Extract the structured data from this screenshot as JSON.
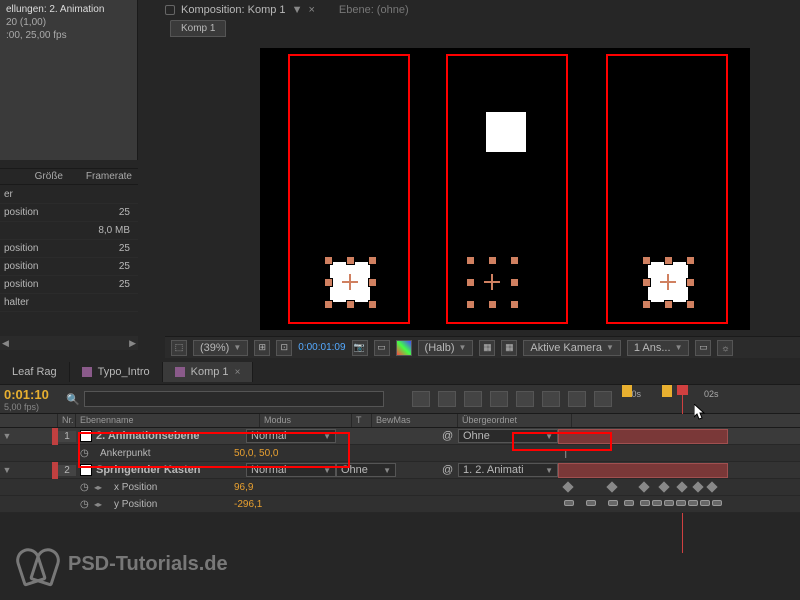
{
  "topTabs": {
    "comp": "Komposition: Komp 1",
    "layer": "Ebene: (ohne)"
  },
  "compTab": "Komp 1",
  "project": {
    "title": "ellungen: 2. Animation",
    "line1": "20 (1,00)",
    "line2": ":00, 25,00 fps"
  },
  "assetHeaders": {
    "size": "Größe",
    "fps": "Framerate"
  },
  "assets": [
    {
      "name": "er",
      "val": ""
    },
    {
      "name": "position",
      "val": "25"
    },
    {
      "name": "",
      "val": "8,0 MB"
    },
    {
      "name": "position",
      "val": "25"
    },
    {
      "name": "position",
      "val": "25"
    },
    {
      "name": "position",
      "val": "25"
    },
    {
      "name": "halter",
      "val": ""
    }
  ],
  "viewerCtrl": {
    "zoom": "(39%)",
    "time": "0:00:01:09",
    "res": "(Halb)",
    "camera": "Aktive Kamera",
    "views": "1 Ans..."
  },
  "tlTabs": {
    "t1": "Leaf Rag",
    "t2": "Typo_Intro",
    "t3": "Komp 1"
  },
  "tlHead": {
    "tc": "0:01:10",
    "frames": "5,00 fps)"
  },
  "ruler": {
    "t0": ":00s",
    "t1": "02s"
  },
  "cols": {
    "nr": "Nr.",
    "name": "Ebenenname",
    "mode": "Modus",
    "t": "T",
    "trk": "BewMas",
    "parent": "Übergeordnet"
  },
  "layers": {
    "l1": {
      "num": "1",
      "name": "2. Animationsebene",
      "mode": "Normal",
      "parent": "Ohne"
    },
    "l1prop": {
      "label": "Ankerpunkt",
      "val": "50,0, 50,0"
    },
    "l2": {
      "num": "2",
      "name": "Springender Kasten",
      "mode": "Normal",
      "trk": "Ohne",
      "parent": "1. 2. Animati"
    },
    "l2p1": {
      "label": "x Position",
      "val": "96,9"
    },
    "l2p2": {
      "label": "y Position",
      "val": "-296,1"
    }
  },
  "watermark": "PSD-Tutorials.de"
}
